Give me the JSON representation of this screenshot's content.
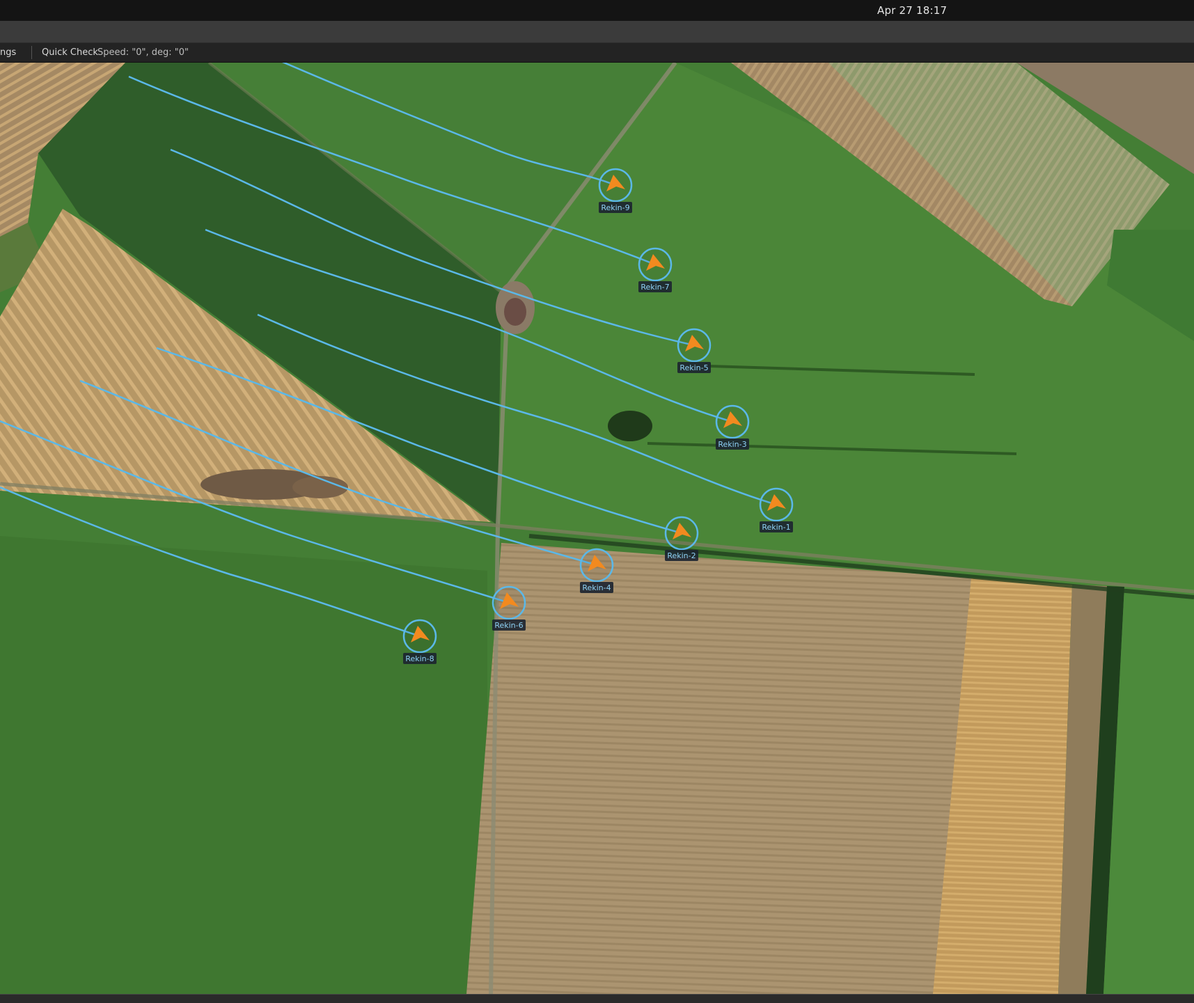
{
  "system": {
    "clock": "Apr 27  18:17"
  },
  "toolbar": {
    "settings_tab": "ngs",
    "quick_check_tab": "Quick Check",
    "status": "Speed: \"0\", deg: \"0\""
  },
  "map": {
    "track_color": "#5bb8e8",
    "marker_color": "#f28a1f",
    "ring_color": "#5bb8e8",
    "label_bg": "#1c2430",
    "label_text_color": "#8fd2f5",
    "vehicles": [
      {
        "id": "rekin-9",
        "label": "Rekin-9"
      },
      {
        "id": "rekin-7",
        "label": "Rekin-7"
      },
      {
        "id": "rekin-5",
        "label": "Rekin-5"
      },
      {
        "id": "rekin-3",
        "label": "Rekin-3"
      },
      {
        "id": "rekin-1",
        "label": "Rekin-1"
      },
      {
        "id": "rekin-2",
        "label": "Rekin-2"
      },
      {
        "id": "rekin-4",
        "label": "Rekin-4"
      },
      {
        "id": "rekin-6",
        "label": "Rekin-6"
      },
      {
        "id": "rekin-8",
        "label": "Rekin-8"
      }
    ]
  }
}
